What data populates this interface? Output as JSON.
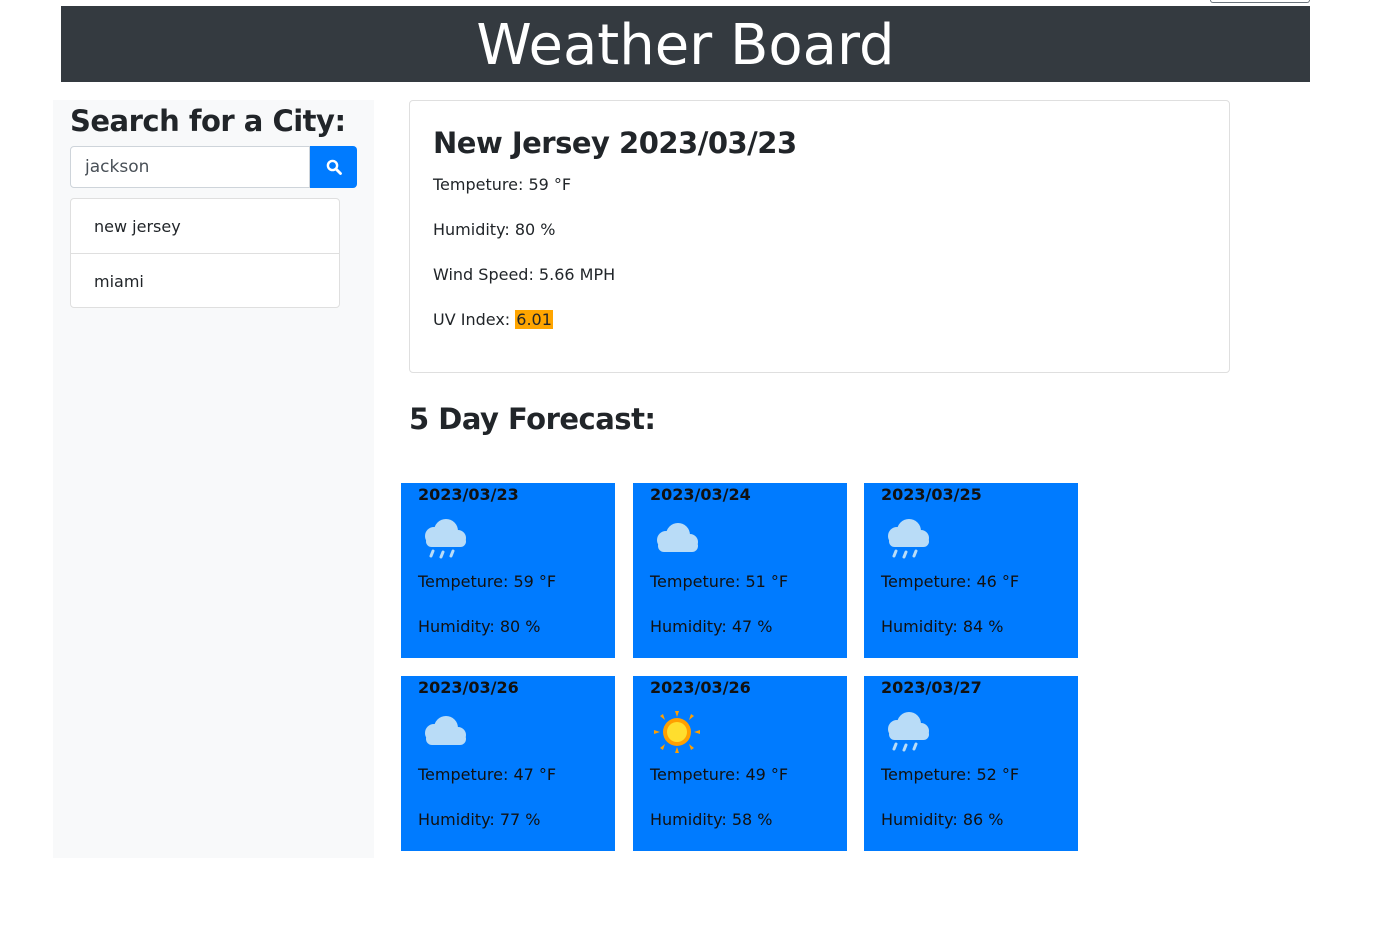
{
  "header": {
    "title": "Weather Board"
  },
  "sidebar": {
    "heading": "Search for a City:",
    "search": {
      "value": "jackson",
      "icon": "search-icon"
    },
    "history": [
      "new jersey",
      "miami"
    ]
  },
  "current": {
    "title": "New Jersey 2023/03/23",
    "temp_label": "Tempeture: 59 °F",
    "humidity_label": "Humidity: 80 %",
    "wind_label": "Wind Speed: 5.66 MPH",
    "uv_prefix": "UV Index: ",
    "uv_value": "6.01",
    "uv_color": "#ffa500"
  },
  "forecast": {
    "title": "5 Day Forecast:",
    "card_color": "#007bff",
    "days": [
      {
        "date": "2023/03/23",
        "icon": "rain-cloud-icon",
        "temp": "Tempeture: 59 °F",
        "humidity": "Humidity: 80 %"
      },
      {
        "date": "2023/03/24",
        "icon": "cloud-icon",
        "temp": "Tempeture: 51 °F",
        "humidity": "Humidity: 47 %"
      },
      {
        "date": "2023/03/25",
        "icon": "rain-cloud-icon",
        "temp": "Tempeture: 46 °F",
        "humidity": "Humidity: 84 %"
      },
      {
        "date": "2023/03/26",
        "icon": "cloud-icon",
        "temp": "Tempeture: 47 °F",
        "humidity": "Humidity: 77 %"
      },
      {
        "date": "2023/03/26",
        "icon": "sun-icon",
        "temp": "Tempeture: 49 °F",
        "humidity": "Humidity: 58 %"
      },
      {
        "date": "2023/03/27",
        "icon": "rain-cloud-icon",
        "temp": "Tempeture: 52 °F",
        "humidity": "Humidity: 86 %"
      }
    ]
  }
}
